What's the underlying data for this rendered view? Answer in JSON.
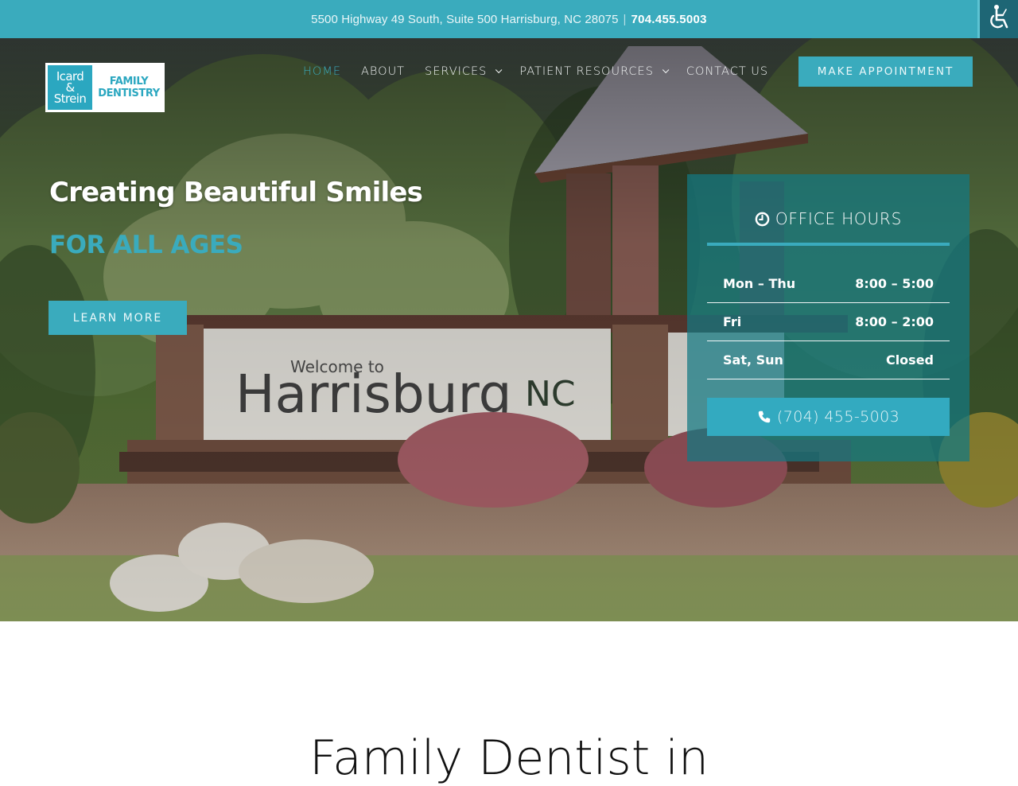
{
  "topbar": {
    "address": "5500 Highway 49 South, Suite 500 Harrisburg, NC 28075",
    "separator": "|",
    "phone": "704.455.5003",
    "accessibility_icon": "wheelchair-icon"
  },
  "logo": {
    "line1": "Icard",
    "line2": "&",
    "line3": "Strein",
    "brand_line1": "FAMILY",
    "brand_line2": "DENTISTRY"
  },
  "nav": {
    "items": [
      {
        "label": "HOME",
        "active": true,
        "has_dropdown": false
      },
      {
        "label": "ABOUT",
        "active": false,
        "has_dropdown": false
      },
      {
        "label": "SERVICES",
        "active": false,
        "has_dropdown": true
      },
      {
        "label": "PATIENT RESOURCES",
        "active": false,
        "has_dropdown": true
      },
      {
        "label": "CONTACT US",
        "active": false,
        "has_dropdown": false
      }
    ],
    "cta_label": "MAKE APPOINTMENT"
  },
  "hero": {
    "title": "Creating Beautiful Smiles",
    "subtitle": "FOR ALL AGES",
    "cta_label": "LEARN MORE",
    "sign_text_small": "Welcome to",
    "sign_text_large": "Harrisburg",
    "sign_text_suffix": "NC"
  },
  "office_hours": {
    "title": "OFFICE HOURS",
    "icon": "clock-icon",
    "rows": [
      {
        "days": "Mon – Thu",
        "hours": "8:00 – 5:00"
      },
      {
        "days": "Fri",
        "hours": "8:00 – 2:00"
      },
      {
        "days": "Sat, Sun",
        "hours": "Closed"
      }
    ],
    "phone_label": "(704) 455-5003",
    "phone_icon": "phone-icon"
  },
  "section": {
    "title": "Family Dentist in"
  },
  "colors": {
    "brand_teal": "#3aabbd",
    "accessibility_dark": "#1e6675",
    "hours_card": "#147882",
    "text_dark": "#111111"
  }
}
